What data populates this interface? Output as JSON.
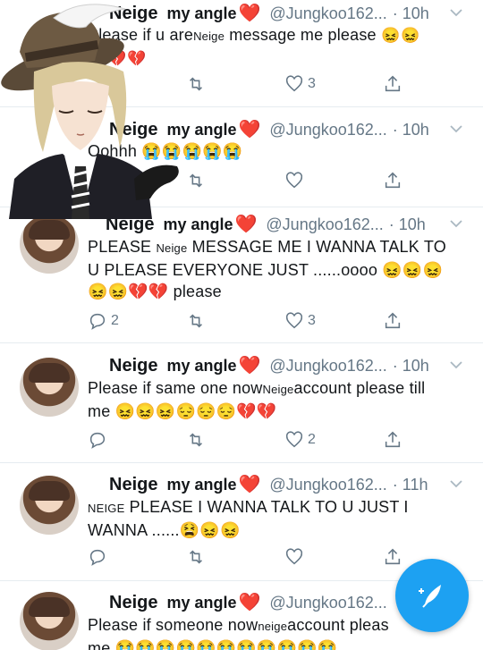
{
  "tweets": [
    {
      "name": "Neige",
      "label": "my angle",
      "heart": "❤️",
      "handle": "@Jungkoo162...",
      "time": "· 10h",
      "text_parts": [
        "Please if u are",
        "Neige",
        " message me please "
      ],
      "emoji_line1": "😖😖",
      "emoji_line2": "😖💔💔",
      "counts": {
        "reply": "",
        "retweet": "",
        "like": "3"
      }
    },
    {
      "name": "Neige",
      "label": "my angle",
      "heart": "❤️",
      "handle": "@Jungkoo162...",
      "time": "· 10h",
      "text": "Oohhh 😭😭😭😭😭",
      "counts": {
        "reply": "",
        "retweet": "",
        "like": ""
      }
    },
    {
      "name": "Neige",
      "label": "my angle",
      "heart": "❤️",
      "handle": "@Jungkoo162...",
      "time": "· 10h",
      "line1a": "PLEASE ",
      "line1b": "Neige",
      "line1c": " MESSAGE ME I WANNA TALK TO",
      "line2": "U PLEASE EVERYONE JUST ......oooo 😖😖😖",
      "line3": "😖😖💔💔 please",
      "counts": {
        "reply": "2",
        "retweet": "",
        "like": "3"
      }
    },
    {
      "name": "Neige",
      "label": "my angle",
      "heart": "❤️",
      "handle": "@Jungkoo162...",
      "time": "· 10h",
      "line1a": "Please if same one now",
      "line1b": "Neige",
      "line1c": "account please till",
      "line2": "me 😖😖😖😔😔😔💔💔",
      "counts": {
        "reply": "",
        "retweet": "",
        "like": "2"
      }
    },
    {
      "name": "Neige",
      "label": "my angle",
      "heart": "❤️",
      "handle": "@Jungkoo162...",
      "time": "· 11h",
      "line1a": "NEIGE",
      "line1c": " PLEASE I WANNA TALK TO U JUST I",
      "line2": "WANNA ......😫😖😖",
      "counts": {
        "reply": "",
        "retweet": "",
        "like": ""
      }
    },
    {
      "name": "Neige",
      "label": "my angle",
      "heart": "❤️",
      "handle": "@Jungkoo162...",
      "time": "",
      "line1a": "Please if someone now",
      "line1b": "neige",
      "line1c": "account pleas",
      "line2": "me 😭😭😭😭😭😭😭😭😭😭😭"
    }
  ],
  "fab": {
    "icon": "compose-feather-icon"
  },
  "colors": {
    "accent": "#1da1f2",
    "heart": "#e0245e",
    "muted": "#657786"
  }
}
